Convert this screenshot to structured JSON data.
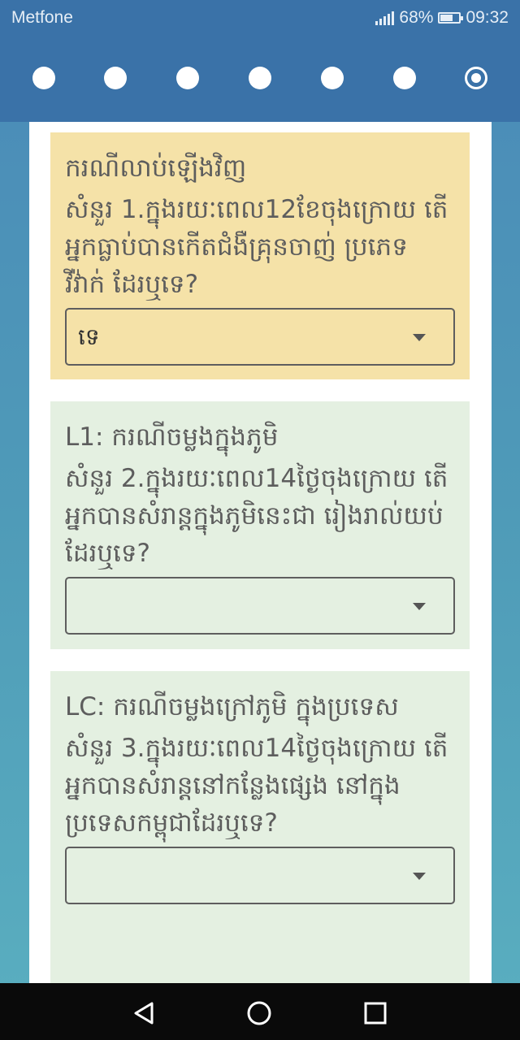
{
  "status_bar": {
    "carrier": "Metfone",
    "battery": "68%",
    "battery_level": 0.68,
    "time": "09:32"
  },
  "progress": {
    "total_steps": 7,
    "current_step": 7
  },
  "questions": [
    {
      "section": "ករណីលាប់ឡើងវិញ",
      "question": "សំនួរ 1.ក្នុងរយៈពេល12ខែចុងក្រោយ តើអ្នកធ្លាប់បានកើតជំងឺគ្រុនចាញ់ ប្រភេទ វីវ៉ាក់ ដែរឬទេ?",
      "selected": "ទេ"
    },
    {
      "section": "L1: ករណីចម្លងក្នុងភូមិ",
      "question": "សំនួរ 2.ក្នុងរយៈពេល14ថ្ងៃចុងក្រោយ តើអ្នកបានសំរាន្តក្នុងភូមិនេះជា រៀងរាល់យប់ដែរឬទេ?",
      "selected": ""
    },
    {
      "section": "LC: ករណីចម្លងក្រៅភូមិ ក្នុងប្រទេស",
      "question": "សំនួរ 3.ក្នុងរយៈពេល14ថ្ងៃចុងក្រោយ តើអ្នកបានសំរាន្តនៅកន្លែងផ្សេង នៅក្នុងប្រទេសកម្ពុជាដែរឬទេ?",
      "selected": ""
    }
  ],
  "colors": {
    "header": "#3a72a8",
    "card_yellow": "#f5e2a8",
    "card_green": "#e4f0e1"
  }
}
